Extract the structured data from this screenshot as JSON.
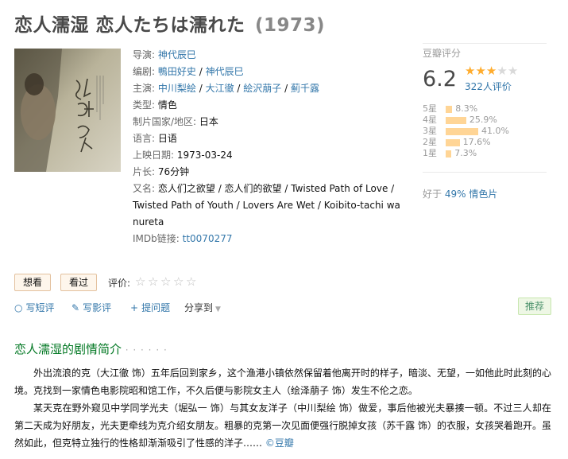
{
  "page": {
    "title": "恋人濡湿 恋人たちは濡れた",
    "year": "(1973)"
  },
  "info": {
    "director_label": "导演:",
    "directors": [
      "神代辰巳"
    ],
    "writer_label": "编剧:",
    "writers": [
      "鴨田好史",
      "神代辰巳"
    ],
    "cast_label": "主演:",
    "cast": [
      "中川梨絵",
      "大江徹",
      "絵沢萠子",
      "薊千露"
    ],
    "genre_label": "类型:",
    "genre": "情色",
    "country_label": "制片国家/地区:",
    "country": "日本",
    "language_label": "语言:",
    "language": "日语",
    "release_label": "上映日期:",
    "release": "1973-03-24",
    "runtime_label": "片长:",
    "runtime": "76分钟",
    "aka_label": "又名:",
    "aka": "恋人们之欲望 / 恋人们的欲望 / Twisted Path of Love / Twisted Path of Youth / Lovers Are Wet / Koibito-tachi wa nureta",
    "imdb_label": "IMDb链接:",
    "imdb": "tt0070277"
  },
  "rating": {
    "header": "豆瓣评分",
    "score": "6.2",
    "stars_value": 3,
    "stars_max": 5,
    "votes": "322人评价",
    "distribution": [
      {
        "label": "5星",
        "pct": "8.3%",
        "value": 8.3
      },
      {
        "label": "4星",
        "pct": "25.9%",
        "value": 25.9
      },
      {
        "label": "3星",
        "pct": "41.0%",
        "value": 41.0
      },
      {
        "label": "2星",
        "pct": "17.6%",
        "value": 17.6
      },
      {
        "label": "1星",
        "pct": "7.3%",
        "value": 7.3
      }
    ],
    "better_prefix": "好于",
    "better_value": "49% 情色片"
  },
  "actions": {
    "want_label": "想看",
    "seen_label": "看过",
    "rate_label": "评价:"
  },
  "toolbar": {
    "short_review": "写短评",
    "review": "写影评",
    "question": "提问题",
    "share": "分享到",
    "recommend": "推荐"
  },
  "summary": {
    "title": "恋人濡湿的剧情简介",
    "dots": "· · · · · ·",
    "p1": "外出流浪的克（大江徹 饰）五年后回到家乡，这个渔港小镇依然保留着他离开时的样子，暗淡、无望，一如他此时此刻的心境。克找到一家情色电影院昭和馆工作，不久后便与影院女主人（绘泽萠子 饰）发生不伦之恋。",
    "p2": "某天克在野外窥见中学同学光夫（堀弘一 饰）与其女友洋子（中川梨绘 饰）做爱，事后他被光夫暴揍一顿。不过三人却在第二天成为好朋友，光夫更牵线为克介绍女朋友。粗暴的克第一次见面便强行脱掉女孩（苏千露 饰）的衣服，女孩哭着跑开。虽然如此，但克特立独行的性格却渐渐吸引了性感的洋子……",
    "source": "©豆瓣"
  }
}
